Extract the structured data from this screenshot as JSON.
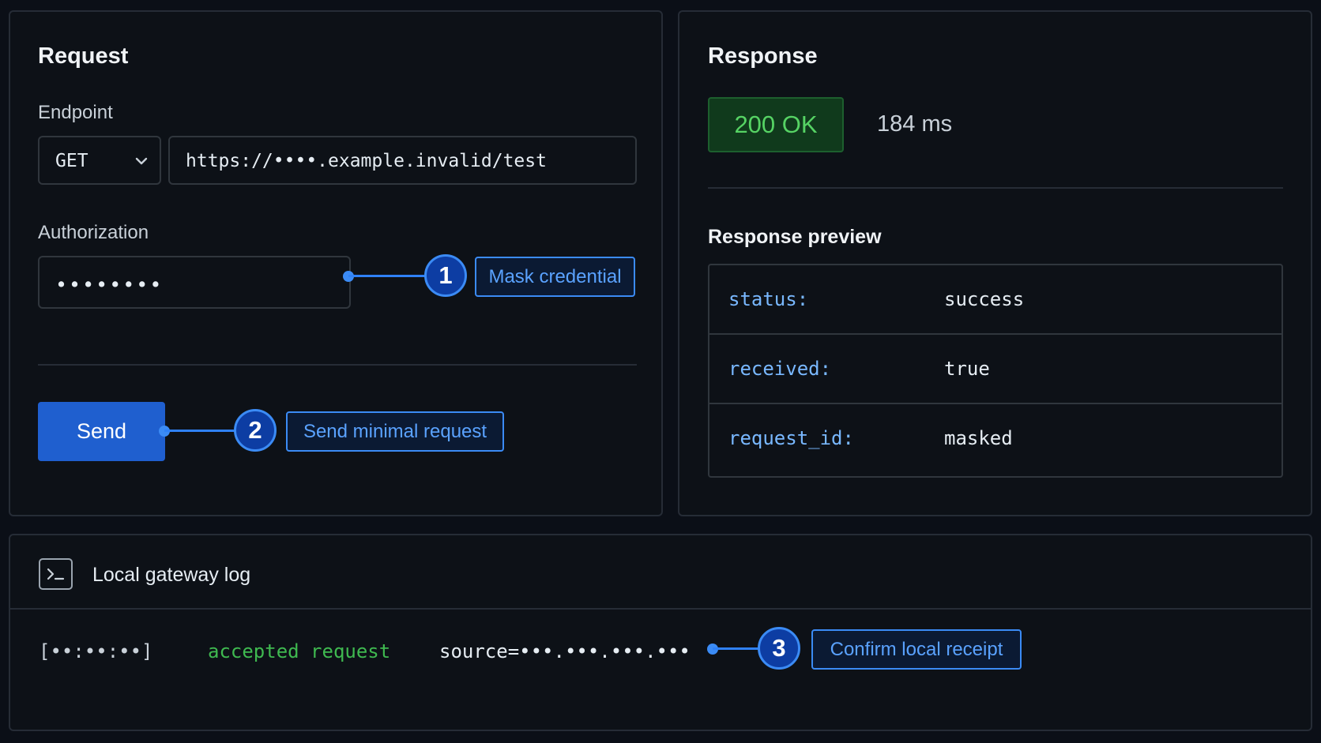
{
  "request": {
    "title": "Request",
    "endpoint_label": "Endpoint",
    "method": "GET",
    "url": "https://••••.example.invalid/test",
    "authorization_label": "Authorization",
    "authorization_value": "••••••••",
    "send_label": "Send"
  },
  "response": {
    "title": "Response",
    "status": "200 OK",
    "time": "184 ms",
    "preview_title": "Response preview",
    "preview_rows": [
      {
        "key": "status:",
        "value": "success"
      },
      {
        "key": "received:",
        "value": "true"
      },
      {
        "key": "request_id:",
        "value": "masked"
      }
    ]
  },
  "log": {
    "title": "Local gateway log",
    "timestamp": "[••:••:••]",
    "message": "accepted request",
    "source": "source=•••.•••.•••.•••"
  },
  "annotations": [
    {
      "number": "1",
      "label": "Mask credential"
    },
    {
      "number": "2",
      "label": "Send minimal request"
    },
    {
      "number": "3",
      "label": "Confirm local receipt"
    }
  ],
  "icons": {
    "method_dropdown": "chevron-down-icon",
    "log_header": "terminal-icon"
  },
  "colors": {
    "background": "#0d1117",
    "accent": "#2f81f7",
    "success": "#56d364",
    "send_button": "#1f5fcf"
  }
}
